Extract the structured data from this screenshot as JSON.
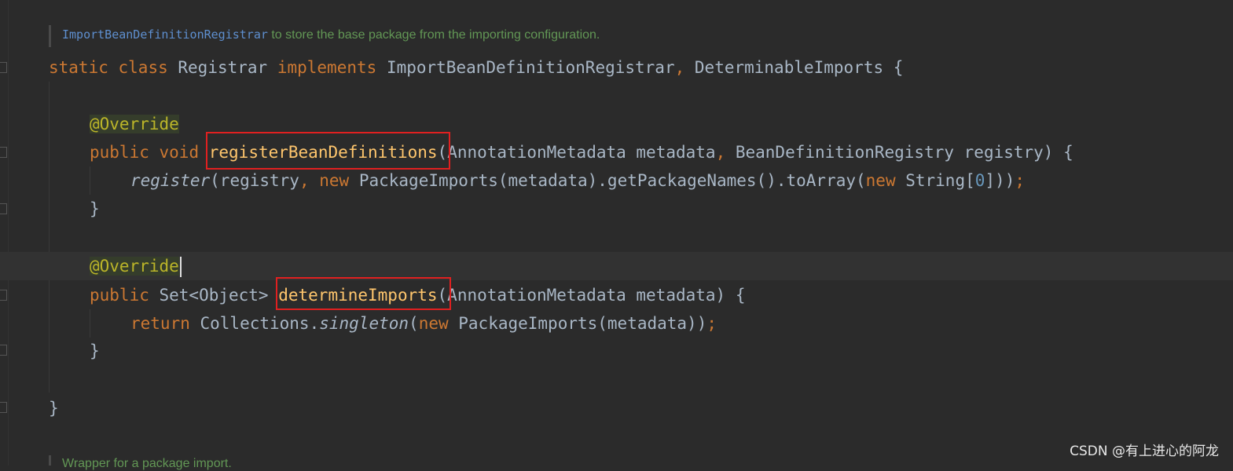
{
  "doc_comment_top": {
    "ref": "ImportBeanDefinitionRegistrar",
    "text": " to store the base package from the importing configuration."
  },
  "code": {
    "l1": {
      "static": "static",
      "class": "class",
      "name": "Registrar",
      "implements": "implements",
      "iface1": "ImportBeanDefinitionRegistrar",
      "comma": ",",
      "iface2": "DeterminableImports",
      "brace": "{"
    },
    "l2": {
      "annotation": "@Override"
    },
    "l3": {
      "public": "public",
      "void": "void",
      "method": "registerBeanDefinitions",
      "params_a": "(AnnotationMetadata metadata",
      "comma": ",",
      "params_b": " BeanDefinitionRegistry registry) {"
    },
    "l4": {
      "call": "register",
      "args_a": "(registry",
      "comma": ",",
      "new1": "new",
      "mid": " PackageImports(metadata).getPackageNames().toArray(",
      "new2": "new",
      "str": " String[",
      "zero": "0",
      "end": "]))",
      "semi": ";"
    },
    "l5": {
      "brace": "}"
    },
    "l6": {
      "annotation": "@Override"
    },
    "l7": {
      "public": "public",
      "ret_type": " Set<Object> ",
      "method": "determineImports",
      "params": "(AnnotationMetadata metadata) {"
    },
    "l8": {
      "return": "return",
      "coll": " Collections.",
      "singleton": "singleton",
      "paren": "(",
      "new": "new",
      "rest": " PackageImports(metadata))",
      "semi": ";"
    },
    "l9": {
      "brace": "}"
    },
    "l10": {
      "brace": "}"
    }
  },
  "doc_comment_bottom": {
    "text": "Wrapper for a package import."
  },
  "watermark": "CSDN @有上进心的阿龙",
  "colors": {
    "background": "#2b2b2b",
    "keyword": "#cc7832",
    "method_decl": "#ffc66d",
    "annotation": "#bbb529",
    "highlight_box": "#e02020",
    "doc_comment": "#629755"
  }
}
